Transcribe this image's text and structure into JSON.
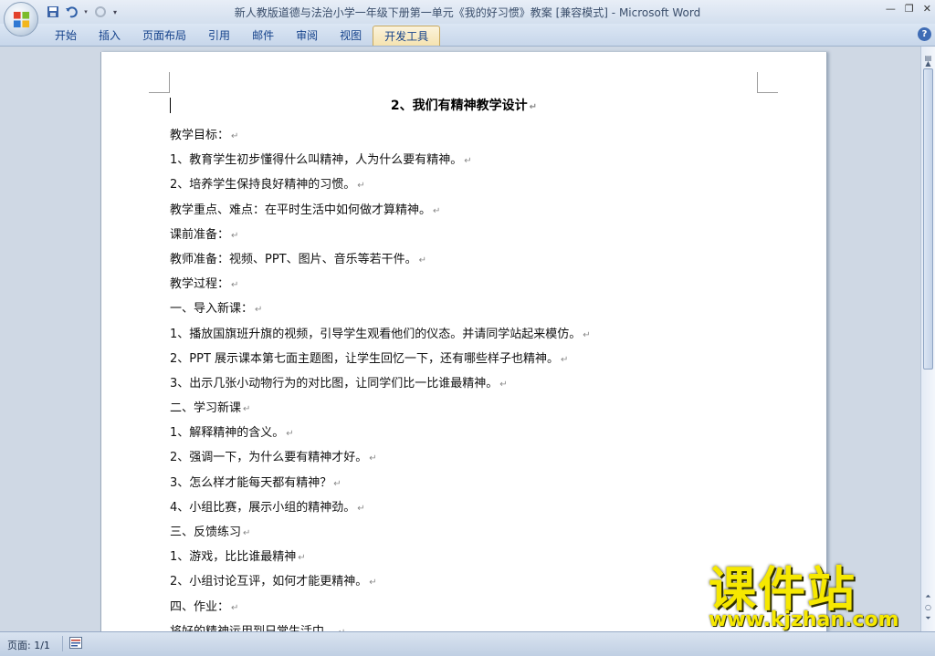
{
  "window": {
    "title_doc": "新人教版道德与法治小学一年级下册第一单元《我的好习惯》教案 [兼容模式]",
    "title_sep": " - ",
    "title_app": "Microsoft Word"
  },
  "ribbon": {
    "tabs": [
      "开始",
      "插入",
      "页面布局",
      "引用",
      "邮件",
      "审阅",
      "视图",
      "开发工具"
    ],
    "active_tab": "开发工具",
    "help": "?"
  },
  "document": {
    "title": "2、我们有精神教学设计",
    "paragraph_mark": "↵",
    "lines": [
      "教学目标：",
      "1、教育学生初步懂得什么叫精神，人为什么要有精神。",
      "2、培养学生保持良好精神的习惯。",
      "教学重点、难点：在平时生活中如何做才算精神。",
      "课前准备：",
      "教师准备：视频、PPT、图片、音乐等若干件。",
      "教学过程：",
      "一、导入新课：",
      "1、播放国旗班升旗的视频，引导学生观看他们的仪态。并请同学站起来模仿。",
      "2、PPT 展示课本第七面主题图，让学生回忆一下，还有哪些样子也精神。",
      "3、出示几张小动物行为的对比图，让同学们比一比谁最精神。",
      "二、学习新课",
      "1、解释精神的含义。",
      "2、强调一下，为什么要有精神才好。",
      "3、怎么样才能每天都有精神？",
      "4、小组比赛，展示小组的精神劲。",
      "三、反馈练习",
      "1、游戏，比比谁最精神",
      "2、小组讨论互评，如何才能更精神。",
      "四、作业：",
      "将好的精神运用到日常生活中。"
    ]
  },
  "statusbar": {
    "page": "页面: 1/1"
  },
  "watermark": {
    "main": "课件站",
    "url": "www.kjzhan.com"
  },
  "colors": {
    "accent": "#15428b",
    "watermark": "#f6e800"
  }
}
